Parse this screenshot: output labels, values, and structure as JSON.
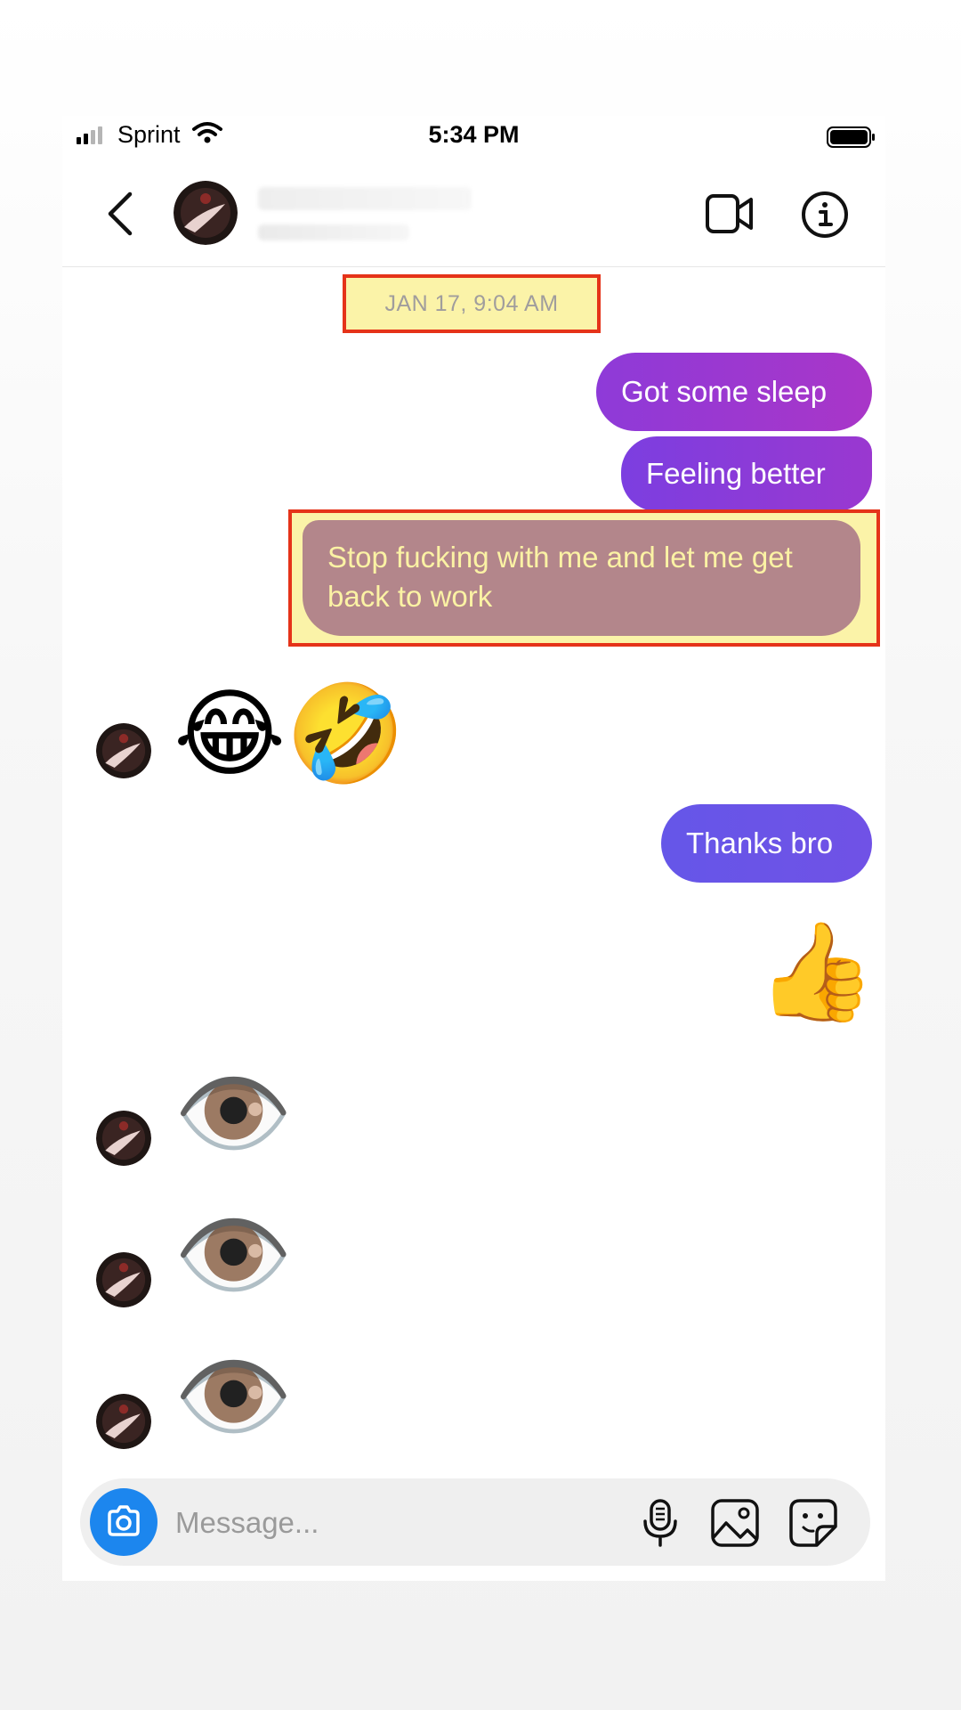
{
  "status_bar": {
    "carrier": "Sprint",
    "time": "5:34 PM"
  },
  "thread": {
    "timestamp": "JAN 17, 9:04 AM",
    "messages": [
      {
        "from": "me",
        "text": "Got some sleep"
      },
      {
        "from": "me",
        "text": "Feeling better"
      },
      {
        "from": "me",
        "text": "Stop fucking with me and let me get back to work",
        "highlighted": true
      },
      {
        "from": "them",
        "text": "😂🤣"
      },
      {
        "from": "me",
        "text": "Thanks bro"
      },
      {
        "from": "me",
        "text": "👍"
      },
      {
        "from": "them",
        "text": "👁️"
      },
      {
        "from": "them",
        "text": "👁️"
      },
      {
        "from": "them",
        "text": "👁️"
      }
    ]
  },
  "composer": {
    "placeholder": "Message..."
  },
  "colors": {
    "highlight_border": "#e53319",
    "highlight_fill": "#fbf3a8",
    "bubble_purple": "#9b37cf",
    "bubble_indigo": "#6a54e7",
    "camera_blue": "#1c86ee"
  },
  "icons": [
    "back-chevron-icon",
    "video-call-icon",
    "info-icon",
    "camera-icon",
    "microphone-icon",
    "gallery-icon",
    "sticker-icon"
  ]
}
